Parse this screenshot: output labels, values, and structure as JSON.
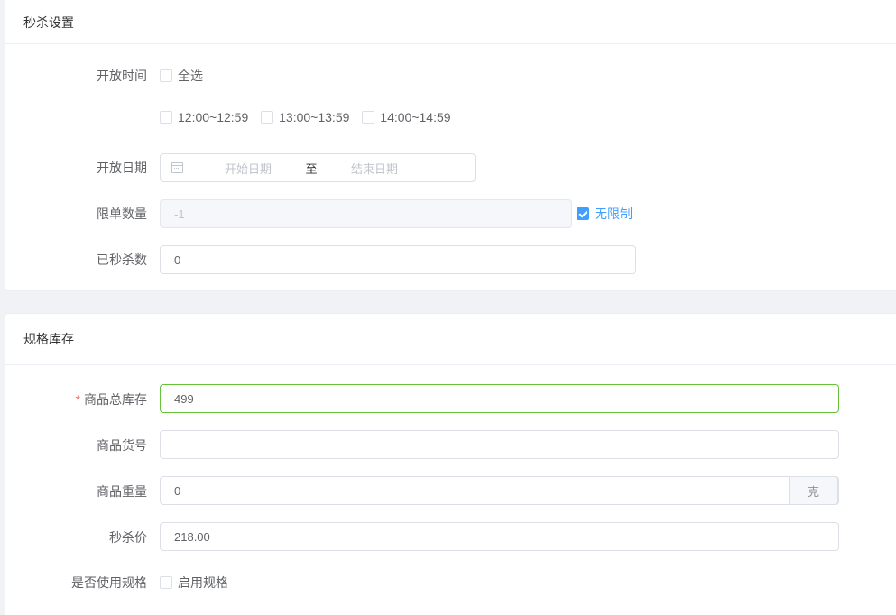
{
  "section1": {
    "title": "秒杀设置",
    "open_time": {
      "label": "开放时间",
      "select_all": "全选",
      "slots": [
        "12:00~12:59",
        "13:00~13:59",
        "14:00~14:59"
      ]
    },
    "open_date": {
      "label": "开放日期",
      "start_placeholder": "开始日期",
      "separator": "至",
      "end_placeholder": "结束日期"
    },
    "limit": {
      "label": "限单数量",
      "value": "-1",
      "unlimited_label": "无限制",
      "unlimited_checked": true
    },
    "sold": {
      "label": "已秒杀数",
      "value": "0"
    }
  },
  "section2": {
    "title": "规格库存",
    "stock": {
      "required_mark": "*",
      "label": "商品总库存",
      "value": "499"
    },
    "sku": {
      "label": "商品货号",
      "value": ""
    },
    "weight": {
      "label": "商品重量",
      "value": "0",
      "unit": "克"
    },
    "price": {
      "label": "秒杀价",
      "value": "218.00"
    },
    "use_spec": {
      "label": "是否使用规格",
      "checkbox_label": "启用规格",
      "checked": false
    }
  },
  "colors": {
    "primary": "#409eff",
    "success_border": "#67c23a",
    "required": "#f56c6c"
  }
}
